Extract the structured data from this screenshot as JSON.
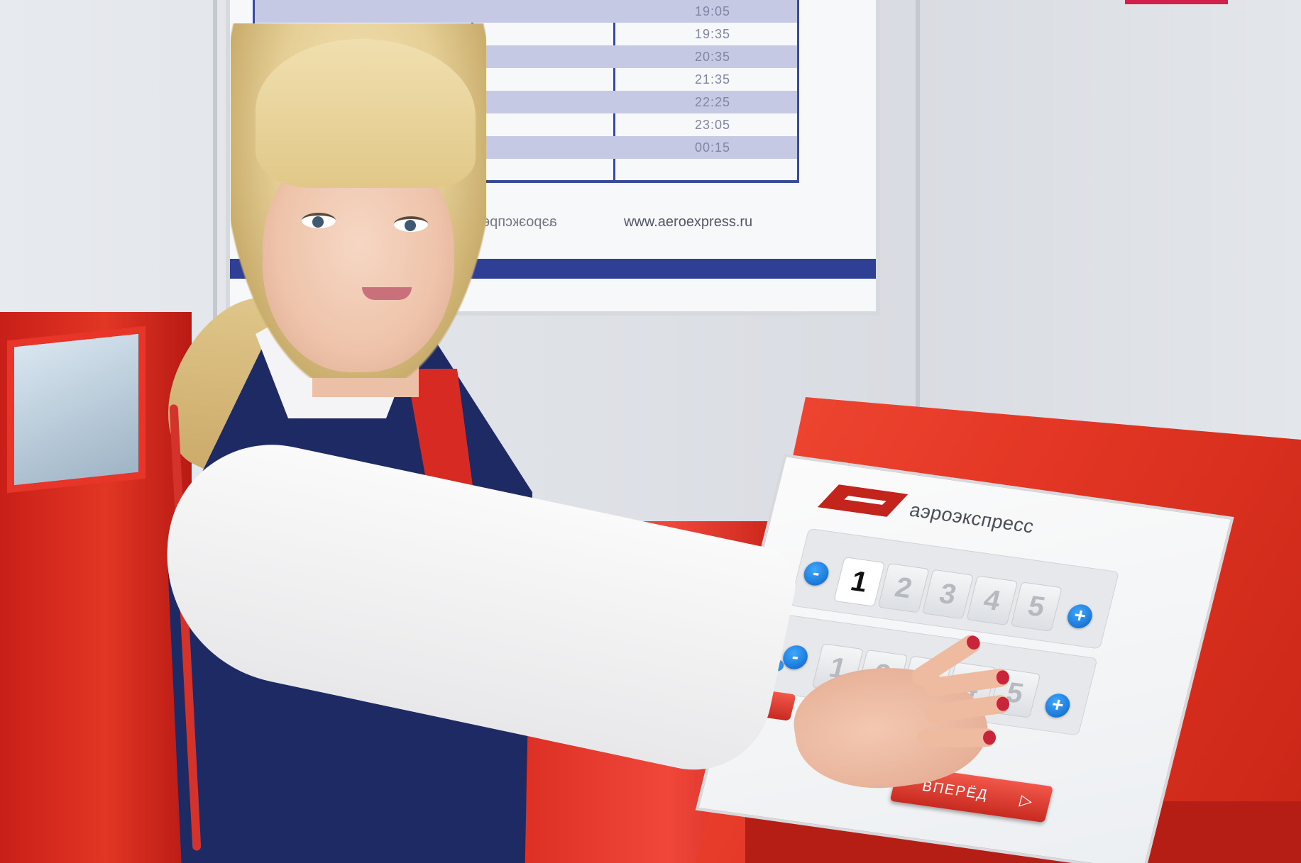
{
  "timetable": {
    "rows": [
      {
        "depart": "",
        "arrive": "19:05"
      },
      {
        "depart": "",
        "arrive": "19:35"
      },
      {
        "depart": "",
        "arrive": "20:35"
      },
      {
        "depart": "",
        "arrive": "21:35"
      },
      {
        "depart": "",
        "arrive": "22:25"
      },
      {
        "depart": "",
        "arrive": "23:05"
      },
      {
        "depart": "",
        "arrive": "00:15"
      }
    ],
    "footer_left": "аэроэкспресс",
    "footer_right": "www.aeroexpress.ru"
  },
  "kiosk": {
    "brand_name": "аэроэкспресс",
    "panel1": {
      "caption": "",
      "minus": "-",
      "plus": "+",
      "digits": [
        "1",
        "2",
        "3",
        "4",
        "5"
      ],
      "selected": "1"
    },
    "panel2": {
      "caption": "",
      "minus": "-",
      "plus": "+",
      "digits": [
        "1",
        "2",
        "3",
        "4",
        "5"
      ]
    },
    "total_text": "",
    "forward_button": "ВПЕРЁД",
    "forward_arrow": "▷"
  },
  "colors": {
    "kiosk_red": "#e33624",
    "brand_red": "#c3241c",
    "board_blue": "#2f3f96",
    "button_blue": "#0b62c4",
    "uniform_navy": "#1d2a63"
  }
}
